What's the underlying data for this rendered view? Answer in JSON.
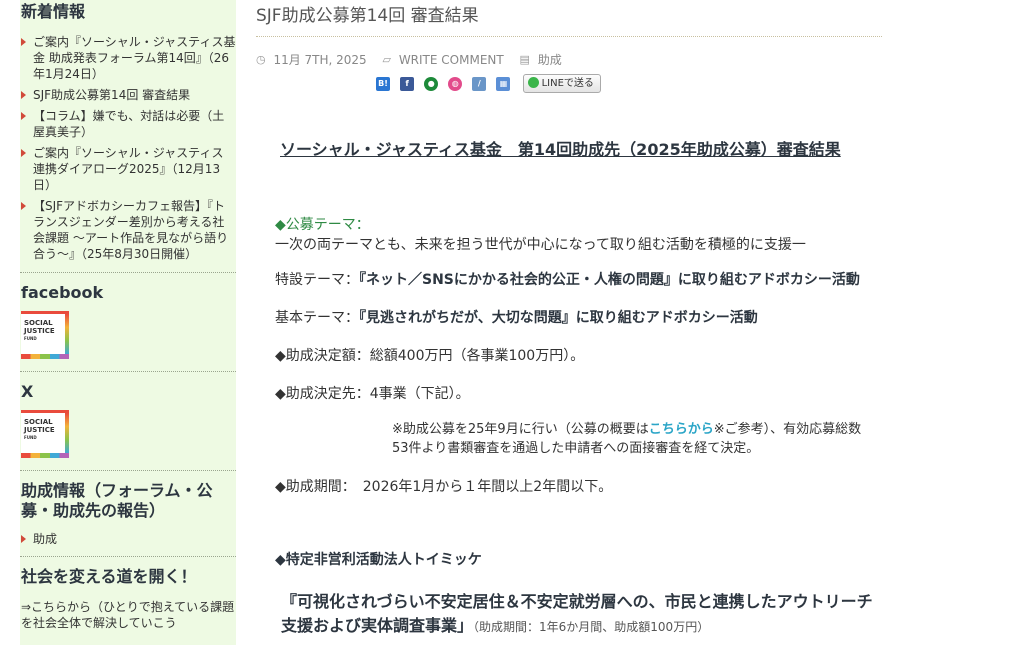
{
  "sidebar": {
    "news": {
      "heading": "新着情報",
      "items": [
        "ご案内『ソーシャル・ジャスティス基金 助成発表フォーラム第14回』（26年1月24日）",
        "SJF助成公募第14回 審査結果",
        "【コラム】嫌でも、対話は必要（土屋真美子）",
        "ご案内『ソーシャル・ジャスティス 連携ダイアローグ2025』（12月13日）",
        "【SJFアドボカシーカフェ報告】『トランスジェンダー差別から考える社会課題 〜アート作品を見ながら語り合う〜』（25年8月30日開催）"
      ]
    },
    "facebook": {
      "heading": "facebook"
    },
    "x": {
      "heading": "X"
    },
    "logo": {
      "line1": "SOCIAL",
      "line2": "JUSTICE",
      "line3": "FUND"
    },
    "grants": {
      "heading": "助成情報（フォーラム・公募・助成先の報告）",
      "items": [
        "助成"
      ]
    },
    "change": {
      "heading": "社会を変える道を開く！",
      "text": "⇒こちらから（ひとりで抱えている課題を社会全体で解決していこう"
    }
  },
  "post": {
    "title": "SJF助成公募第14回 審査結果",
    "meta": {
      "date": "11月 7TH, 2025",
      "comment": "WRITE COMMENT",
      "category": "助成"
    },
    "share": {
      "line_label": "LINEで送る"
    },
    "headline": "ソーシャル・ジャスティス基金　第14回助成先（2025年助成公募）審査結果",
    "theme_label": "◆公募テーマ：",
    "theme_text": "一次の両テーマとも、未来を担う世代が中心になって取り組む活動を積極的に支援一",
    "special_label": "特設テーマ：",
    "special_text": "『ネット／SNSにかかる社会的公正・人権の問題』に取り組むアドボカシー活動",
    "basic_label": "基本テーマ：",
    "basic_text": "『見逃されがちだが、大切な問題』に取り組むアドボカシー活動",
    "amount": "◆助成決定額：総額400万円（各事業100万円）。",
    "recipients": "◆助成決定先：4事業（下記）。",
    "note_pre": "※助成公募を25年9月に行い（公募の概要は",
    "note_link": "こちらから",
    "note_post": "※ご参考）、有効応募総数53件より書類審査を通過した申請者への面接審査を経て決定。",
    "period": "◆助成期間：　2026年1月から１年間以上2年間以下。",
    "org": "◆特定非営利活動法人トイミッケ",
    "project": "『可視化されづらい不安定居住＆不安定就労層への、市民と連携したアウトリーチ支援および実体調査事業」",
    "project_note": "（助成期間：1年6か月間、助成額100万円）"
  }
}
